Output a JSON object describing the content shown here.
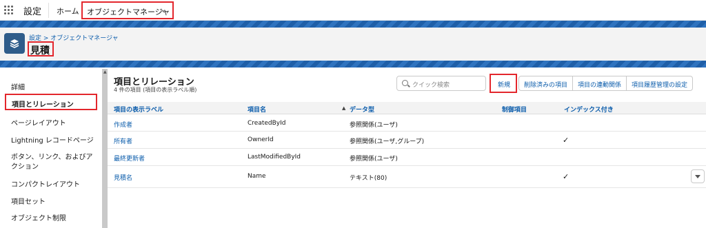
{
  "topnav": {
    "app_name": "設定",
    "tabs": [
      "ホーム"
    ],
    "active_tab": "オブジェクトマネージャ"
  },
  "header": {
    "breadcrumb": "設定 > オブジェクトマネージャ",
    "title": "見積"
  },
  "sidebar": {
    "items": [
      "詳細",
      "項目とリレーション",
      "ページレイアウト",
      "Lightning レコードページ",
      "ボタン、リンク、およびア",
      "クション",
      "コンパクトレイアウト",
      "項目セット",
      "オブジェクト制限"
    ]
  },
  "main": {
    "title": "項目とリレーション",
    "subtitle": "4 件の項目 (項目の表示ラベル順)",
    "search_placeholder": "クイック検索",
    "buttons": {
      "new": "新規",
      "deleted": "削除済みの項目",
      "dependencies": "項目の連動関係",
      "history": "項目履歴管理の設定"
    }
  },
  "table": {
    "headers": [
      "項目の表示ラベル",
      "項目名",
      "データ型",
      "制御項目",
      "インデックス付き"
    ],
    "rows": [
      {
        "label": "作成者",
        "name": "CreatedById",
        "type": "参照関係(ユーザ)",
        "indexed": false
      },
      {
        "label": "所有者",
        "name": "OwnerId",
        "type": "参照関係(ユーザ,グループ)",
        "indexed": true
      },
      {
        "label": "最終更新者",
        "name": "LastModifiedById",
        "type": "参照関係(ユーザ)",
        "indexed": false
      },
      {
        "label": "見積名",
        "name": "Name",
        "type": "テキスト(80)",
        "indexed": true
      }
    ],
    "check_glyph": "✓"
  }
}
